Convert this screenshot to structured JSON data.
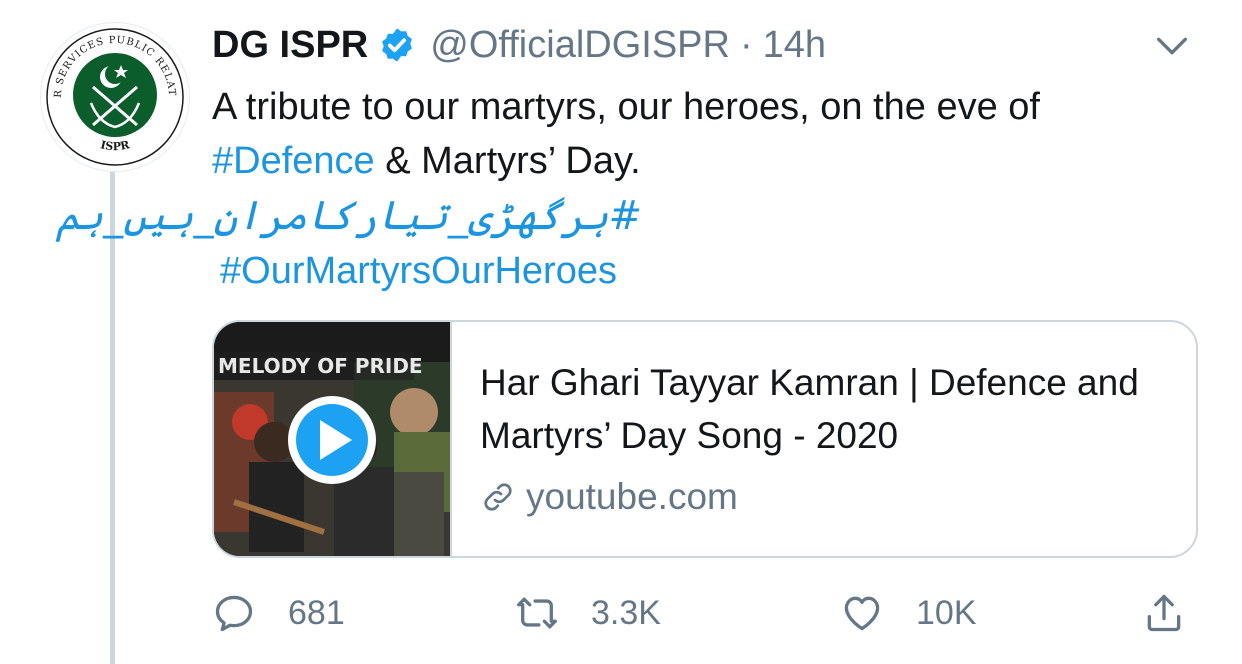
{
  "tweet": {
    "display_name": "DG ISPR",
    "handle": "@OfficialDGISPR",
    "separator": "·",
    "time": "14h",
    "text_line1": "A tribute to our martyrs, our heroes, on the eve of",
    "hashtag_defence": "#Defence",
    "text_line2_rest": " & Martyrs’ Day.",
    "urdu_hashtag": "#ہرگھڑی_تیارکامران_ہیں_ہم",
    "hashtag_heroes": "#OurMartyrsOurHeroes"
  },
  "avatar": {
    "ring_text_top": "INTER SERVICES PUBLIC RELATIONS",
    "ring_text_bottom": "ISPR",
    "colors": {
      "green": "#0b5d2c",
      "white": "#ffffff",
      "dark": "#1a1a1a"
    }
  },
  "card": {
    "thumb_banner": "MELODY OF PRIDE",
    "title": "Har Ghari Tayyar Kamran | Defence and Martyrs’ Day Song - 2020",
    "domain": "youtube.com"
  },
  "actions": {
    "replies": "681",
    "retweets": "3.3K",
    "likes": "10K"
  },
  "icons": {
    "verified": "verified-badge-icon",
    "chevron": "chevron-down-icon",
    "play": "play-icon",
    "link": "link-icon",
    "reply": "reply-icon",
    "retweet": "retweet-icon",
    "like": "heart-icon",
    "share": "share-icon"
  },
  "colors": {
    "accent": "#1b95e0",
    "secondary_text": "#657786",
    "border": "#ccd6dd",
    "verified": "#1da1f2"
  }
}
